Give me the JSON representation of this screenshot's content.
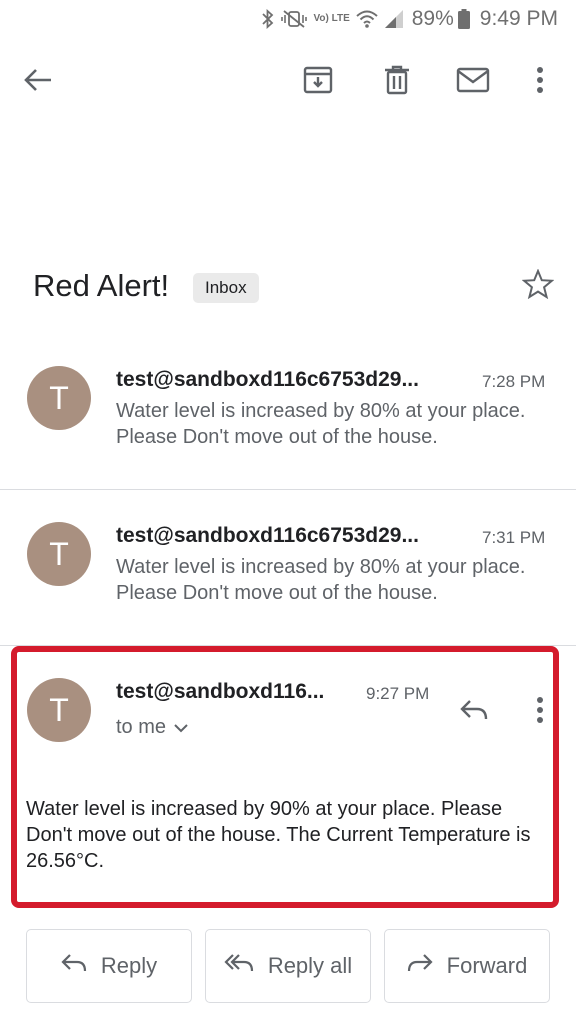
{
  "status_bar": {
    "battery": "89%",
    "time": "9:49 PM",
    "network": "Vo) LTE"
  },
  "toolbar": {
    "icons": [
      "back-arrow-icon",
      "archive-icon",
      "delete-icon",
      "mail-icon",
      "more-vert-icon"
    ]
  },
  "subject": {
    "title": "Red Alert!",
    "label": "Inbox"
  },
  "messages": [
    {
      "avatar": "T",
      "sender": "test@sandboxd116c6753d29...",
      "time": "7:28 PM",
      "snippet": "Water level is increased by 80% at your place. Please Don't move out of the house."
    },
    {
      "avatar": "T",
      "sender": "test@sandboxd116c6753d29...",
      "time": "7:31 PM",
      "snippet": "Water level is increased by 80% at your place. Please Don't move out of the house."
    }
  ],
  "expanded": {
    "avatar": "T",
    "sender": "test@sandboxd116...",
    "time": "9:27 PM",
    "recipient": "to me",
    "body": "Water level is increased by 90% at your place. Please Don't move out of the house. The Current Temperature is 26.56°C."
  },
  "actions": {
    "reply": "Reply",
    "reply_all": "Reply all",
    "forward": "Forward"
  },
  "colors": {
    "avatar": "#a99080",
    "highlight": "#d41b2c",
    "icon": "#5f6368"
  }
}
